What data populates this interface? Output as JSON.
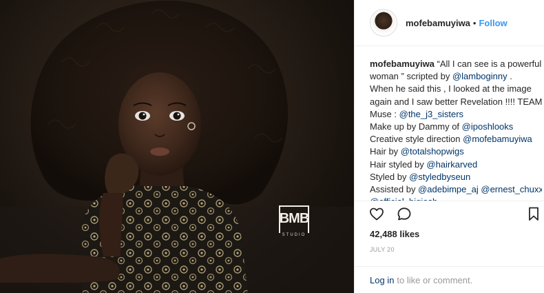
{
  "post": {
    "watermark_text": "BMB",
    "watermark_sub": "STUDIO"
  },
  "header": {
    "username": "mofebamuyiwa",
    "separator": "•",
    "follow_label": "Follow"
  },
  "caption": {
    "lines": [
      {
        "segments": [
          {
            "t": "mofebamuyiwa",
            "k": "user"
          },
          {
            "t": " “All I can see is a powerful",
            "k": "text"
          }
        ]
      },
      {
        "segments": [
          {
            "t": "woman ” scripted by ",
            "k": "text"
          },
          {
            "t": "@lamboginny",
            "k": "mention"
          },
          {
            "t": " .",
            "k": "text"
          }
        ]
      },
      {
        "segments": [
          {
            "t": "When he said this , I looked at the image",
            "k": "text"
          }
        ]
      },
      {
        "segments": [
          {
            "t": "again and I saw better Revelation !!!! TEAM",
            "k": "text"
          }
        ]
      },
      {
        "segments": [
          {
            "t": "Muse : ",
            "k": "text"
          },
          {
            "t": "@the_j3_sisters",
            "k": "mention"
          }
        ]
      },
      {
        "segments": [
          {
            "t": "Make up by Dammy of ",
            "k": "text"
          },
          {
            "t": "@iposhlooks",
            "k": "mention"
          }
        ]
      },
      {
        "segments": [
          {
            "t": "Creative style direction ",
            "k": "text"
          },
          {
            "t": "@mofebamuyiwa",
            "k": "mention"
          }
        ]
      },
      {
        "segments": [
          {
            "t": "Hair by ",
            "k": "text"
          },
          {
            "t": "@totalshopwigs",
            "k": "mention"
          }
        ]
      },
      {
        "segments": [
          {
            "t": "Hair styled by ",
            "k": "text"
          },
          {
            "t": "@hairkarved",
            "k": "mention"
          }
        ]
      },
      {
        "segments": [
          {
            "t": "Styled by ",
            "k": "text"
          },
          {
            "t": "@styledbyseun",
            "k": "mention"
          }
        ]
      },
      {
        "segments": [
          {
            "t": "Assisted by ",
            "k": "text"
          },
          {
            "t": "@adebimpe_aj",
            "k": "mention"
          },
          {
            "t": " ",
            "k": "text"
          },
          {
            "t": "@ernest_chuxx",
            "k": "mention"
          }
        ]
      },
      {
        "segments": [
          {
            "t": "@official_bigjosh",
            "k": "mention"
          }
        ]
      }
    ]
  },
  "actions": {
    "icons": [
      "heart-icon",
      "comment-icon",
      "bookmark-icon"
    ]
  },
  "likes": "42,488 likes",
  "date": "JULY 20",
  "login": {
    "link_label": "Log in",
    "rest_text": "to like or comment."
  },
  "colors": {
    "link": "#003569",
    "follow": "#3897f0",
    "muted": "#999999",
    "border": "#efefef"
  }
}
